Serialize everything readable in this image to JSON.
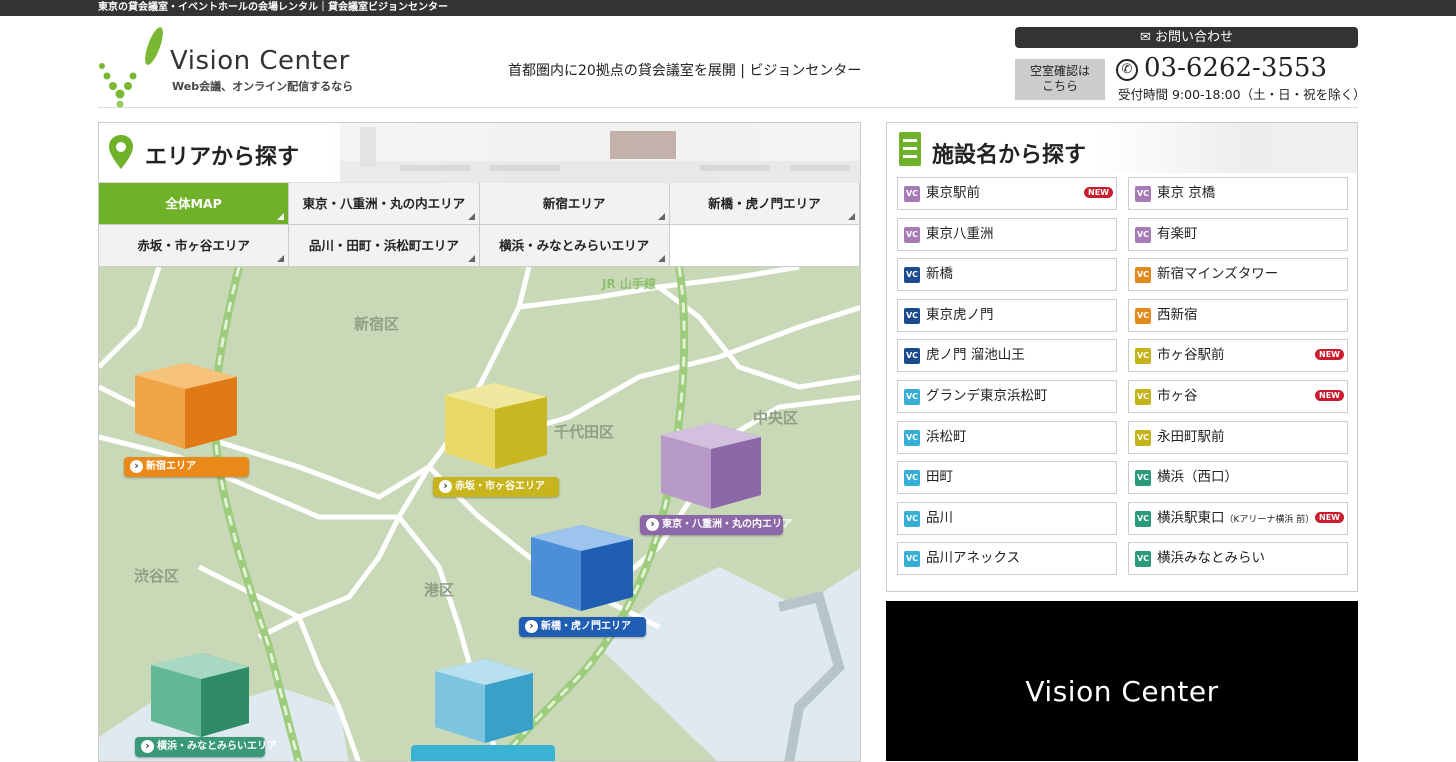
{
  "topbar": {
    "text": "東京の貸会議室・イベントホールの会場レンタル｜貸会議室ビジョンセンター"
  },
  "header": {
    "logo_title": "Vision Center",
    "logo_sub": "Web会議、オンライン配信するなら",
    "tagline": "首都圏内に20拠点の貸会議室を展開 | ビジョンセンター",
    "contact_label": "お問い合わせ",
    "vacancy_label_1": "空室確認は",
    "vacancy_label_2": "こちら",
    "phone": "03-6262-3553",
    "hours": "受付時間 9:00-18:00（土・日・祝を除く）"
  },
  "area_panel": {
    "title": "エリアから探す",
    "tabs": [
      "全体MAP",
      "東京・八重洲・丸の内エリア",
      "新宿エリア",
      "新橋・虎ノ門エリア",
      "赤坂・市ヶ谷エリア",
      "品川・田町・浜松町エリア",
      "横浜・みなとみらいエリア"
    ],
    "wards": [
      "新宿区",
      "千代田区",
      "中央区",
      "渋谷区",
      "港区"
    ],
    "jr_line": "JR 山手線",
    "area_labels": [
      "新宿エリア",
      "赤坂・市ヶ谷エリア",
      "東京・八重洲・丸の内エリア",
      "新橋・虎ノ門エリア",
      "横浜・みなとみらいエリア"
    ]
  },
  "facility_panel": {
    "title": "施設名から探す",
    "vc_label": "VC",
    "new_label": "NEW",
    "items": [
      {
        "name": "東京駅前",
        "new": true,
        "color": "#a77bb5"
      },
      {
        "name": "東京 京橋",
        "new": false,
        "color": "#a77bb5"
      },
      {
        "name": "東京八重洲",
        "new": false,
        "color": "#a77bb5"
      },
      {
        "name": "有楽町",
        "new": false,
        "color": "#a77bb5"
      },
      {
        "name": "新橋",
        "new": false,
        "color": "#1c4b8f"
      },
      {
        "name": "新宿マインズタワー",
        "new": false,
        "color": "#e38a1e"
      },
      {
        "name": "東京虎ノ門",
        "new": false,
        "color": "#1c4b8f"
      },
      {
        "name": "西新宿",
        "new": false,
        "color": "#e38a1e"
      },
      {
        "name": "虎ノ門 溜池山王",
        "new": false,
        "color": "#1c4b8f"
      },
      {
        "name": "市ヶ谷駅前",
        "new": true,
        "color": "#c4b31b"
      },
      {
        "name": "グランデ東京浜松町",
        "new": false,
        "color": "#37aed6"
      },
      {
        "name": "市ヶ谷",
        "new": true,
        "color": "#c4b31b"
      },
      {
        "name": "浜松町",
        "new": false,
        "color": "#37aed6"
      },
      {
        "name": "永田町駅前",
        "new": false,
        "color": "#c4b31b"
      },
      {
        "name": "田町",
        "new": false,
        "color": "#37aed6"
      },
      {
        "name": "横浜（西口）",
        "new": false,
        "color": "#2a9a7a"
      },
      {
        "name": "品川",
        "new": false,
        "color": "#37aed6"
      },
      {
        "name": "横浜駅東口",
        "note": "（Kアリーナ横浜 前）",
        "new": true,
        "color": "#2a9a7a"
      },
      {
        "name": "品川アネックス",
        "new": false,
        "color": "#37aed6"
      },
      {
        "name": "横浜みなとみらい",
        "new": false,
        "color": "#2a9a7a"
      }
    ]
  },
  "video": {
    "title": "Vision Center"
  }
}
